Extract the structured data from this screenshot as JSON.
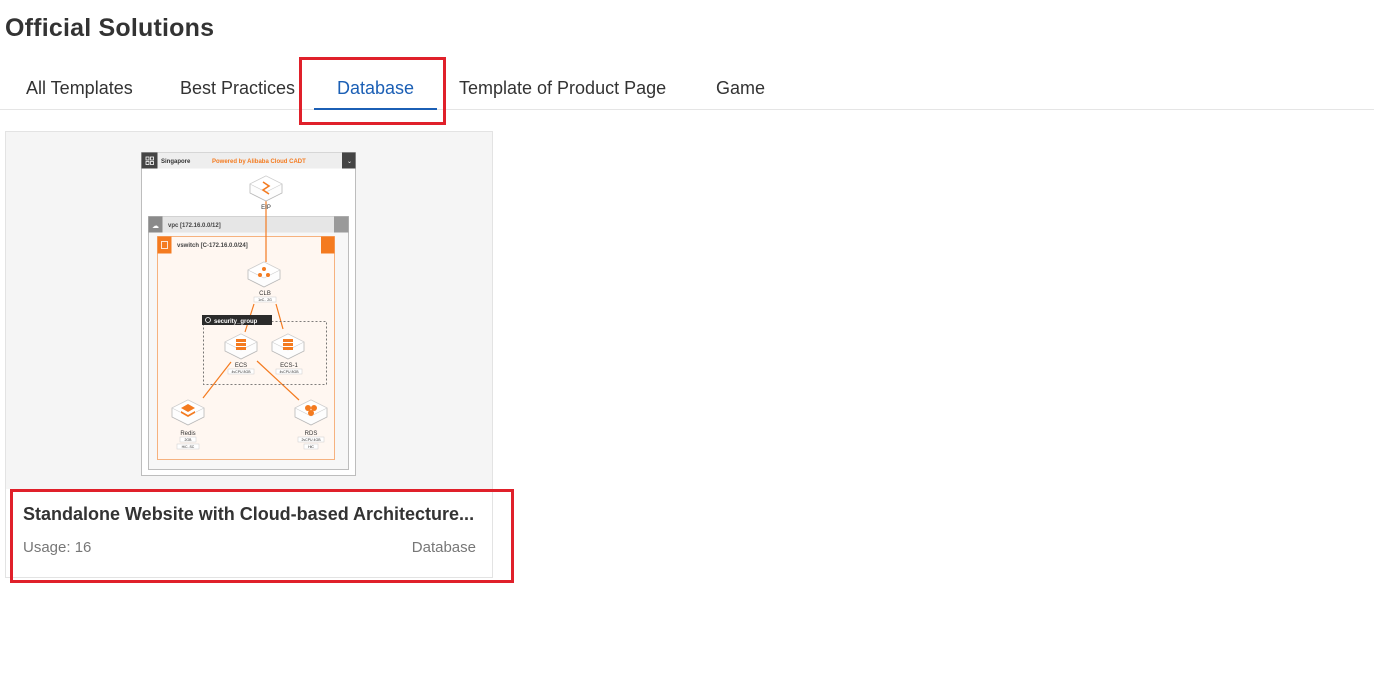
{
  "page": {
    "title": "Official Solutions"
  },
  "tabs": [
    {
      "label": "All Templates",
      "active": false
    },
    {
      "label": "Best Practices",
      "active": false
    },
    {
      "label": "Database",
      "active": true
    },
    {
      "label": "Template of Product Page",
      "active": false
    },
    {
      "label": "Game",
      "active": false
    }
  ],
  "colors": {
    "accent": "#1b5fb5",
    "highlight": "#e0202a",
    "diagram_orange": "#f47b20"
  },
  "cards": [
    {
      "title": "Standalone Website with Cloud-based Architecture...",
      "usage": "Usage: 16",
      "category": "Database",
      "diagram": {
        "region_label": "Singapore",
        "powered_by": "Powered by Alibaba Cloud CADT",
        "vpc_label": "vpc [172.16.0.0/12]",
        "vswitch_label": "vswitch [C-172.16.0.0/24]",
        "security_group_label": "security_group",
        "nodes": {
          "eip": "EIP",
          "clb": "CLB",
          "clb_spec": "1vC.. 2G",
          "ecs": "ECS",
          "ecs_spec": "4vCPU 8GB",
          "ecs1": "ECS-1",
          "ecs1_spec": "4vCPU 8GB",
          "redis": "Redis",
          "redis_spec1": "2GB",
          "redis_spec2": "HiC..SC",
          "rds": "RDS",
          "rds_spec1": "2vCPU 4GB",
          "rds_spec2": "HiC"
        }
      }
    }
  ]
}
